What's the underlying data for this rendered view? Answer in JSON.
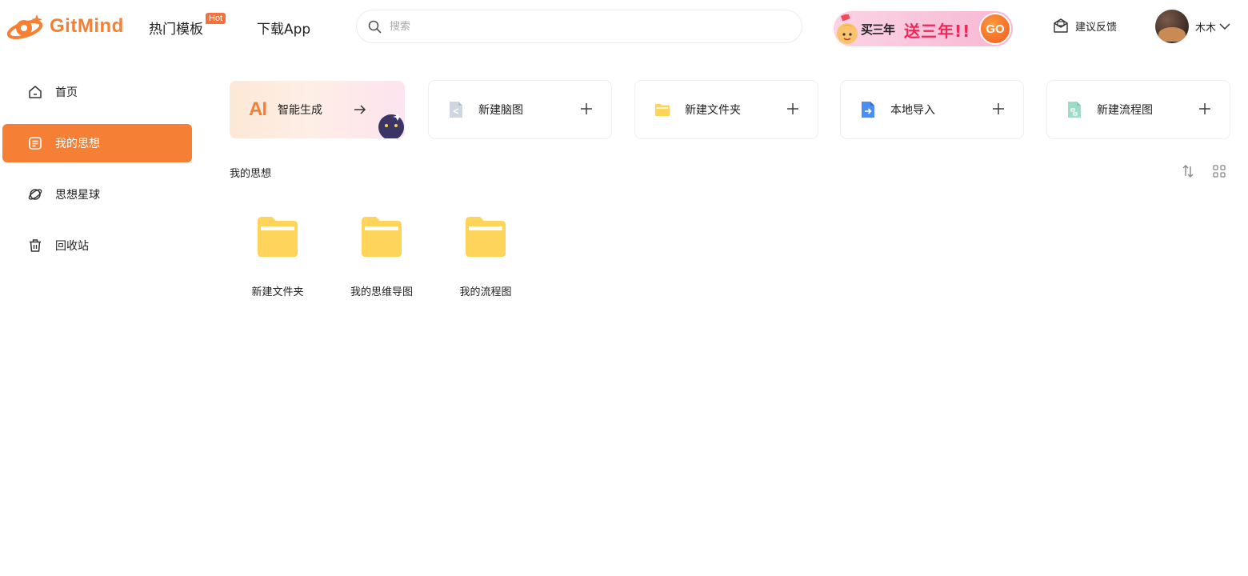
{
  "brand": {
    "name": "GitMind",
    "accent": "#F57F33"
  },
  "nav": {
    "templates": "热门模板",
    "hot_badge": "Hot",
    "download": "下载App"
  },
  "search": {
    "placeholder": "搜索",
    "value": ""
  },
  "promo": {
    "text1": "买三年",
    "text2": "送三年!!",
    "go": "GO"
  },
  "header": {
    "feedback": "建议反馈",
    "user_name": "木木"
  },
  "sidebar": {
    "items": [
      {
        "label": "首页",
        "icon": "home-icon",
        "active": false
      },
      {
        "label": "我的思想",
        "icon": "document-icon",
        "active": true
      },
      {
        "label": "思想星球",
        "icon": "planet-icon",
        "active": false
      },
      {
        "label": "回收站",
        "icon": "trash-icon",
        "active": false
      }
    ]
  },
  "quick_actions": {
    "ai": {
      "mark": "AI",
      "label": "智能生成"
    },
    "items": [
      {
        "label": "新建脑图",
        "icon": "mindmap-file-icon"
      },
      {
        "label": "新建文件夹",
        "icon": "folder-icon"
      },
      {
        "label": "本地导入",
        "icon": "import-file-icon"
      },
      {
        "label": "新建流程图",
        "icon": "flowchart-file-icon"
      }
    ]
  },
  "section": {
    "title": "我的思想"
  },
  "folders": [
    {
      "name": "新建文件夹"
    },
    {
      "name": "我的思维导图"
    },
    {
      "name": "我的流程图"
    }
  ],
  "colors": {
    "active_sidebar": "#F58035",
    "folder": "#FFD45A",
    "hot_badge": "#F5703A"
  }
}
